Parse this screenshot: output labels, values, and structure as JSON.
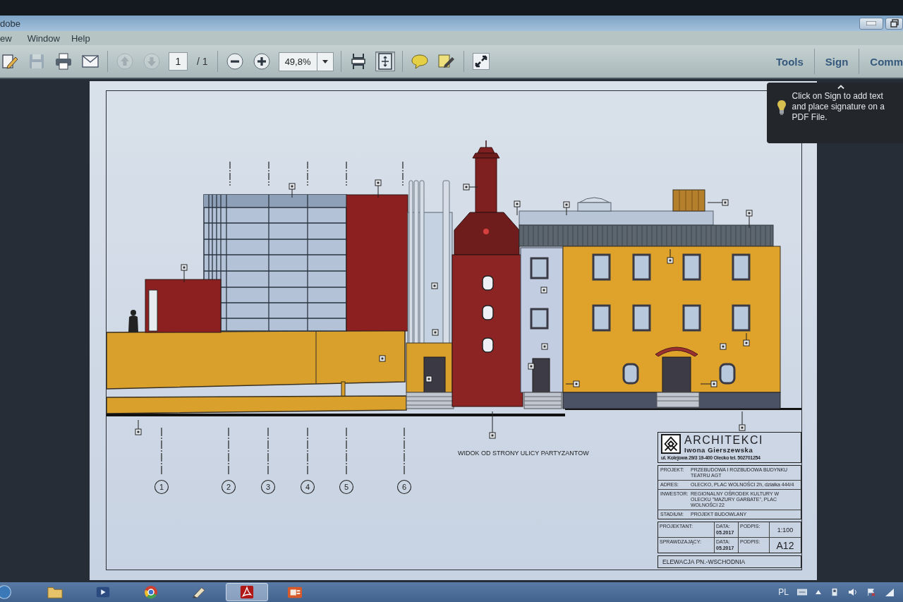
{
  "window": {
    "title": "dobe",
    "menu": [
      "ew",
      "Window",
      "Help"
    ]
  },
  "toolbar": {
    "groups": [
      [
        {
          "kind": "edit",
          "disabled": false
        },
        {
          "kind": "save",
          "disabled": true
        },
        {
          "kind": "print",
          "disabled": false
        },
        {
          "kind": "email",
          "disabled": false
        }
      ],
      [
        {
          "kind": "previous",
          "disabled": true
        },
        {
          "kind": "next",
          "disabled": true
        },
        {
          "kind": "page_field",
          "value": "1",
          "total": "/ 1"
        }
      ],
      [
        {
          "kind": "zoom_out",
          "disabled": false
        },
        {
          "kind": "zoom_in",
          "disabled": false
        },
        {
          "kind": "zoom_field",
          "value": "49,8%"
        }
      ],
      [
        {
          "kind": "scroll_mode",
          "selected": false
        },
        {
          "kind": "fit_page",
          "selected": true
        }
      ],
      [
        {
          "kind": "comment",
          "disabled": false
        },
        {
          "kind": "sign",
          "disabled": false
        }
      ],
      [
        {
          "kind": "full_screen",
          "disabled": false
        }
      ]
    ],
    "panes": [
      {
        "label": "Tools"
      },
      {
        "label": "Sign"
      },
      {
        "label": "Comm"
      }
    ]
  },
  "tooltip": {
    "text": "Click on Sign to add text and place signature on a PDF File."
  },
  "document": {
    "axes": [
      "1",
      "2",
      "3",
      "4",
      "5",
      "6"
    ],
    "caption": "WIDOK OD STRONY ULICY PARTYZANTOW",
    "title_block": {
      "firm": "ARCHITEKCI",
      "architect": "Iwona Gierszewska",
      "address": "ul. Kolejowa 29/3 19-400 Olecko tel. 502701254",
      "fields": [
        {
          "label": "PROJEKT:",
          "value": "PRZEBUDOWA I ROZBUDOWA BUDYNKU TEATRU AGT"
        },
        {
          "label": "ADRES:",
          "value": "OLECKO, PLAC WOLNOŚCI 2h, działka 444/4"
        },
        {
          "label": "INWESTOR:",
          "value": "REGIONALNY OŚRODEK KULTURY W OLECKU \"MAZURY GARBATE\", PLAC WOLNOŚCI 22"
        },
        {
          "label": "STADIUM:",
          "value": "PROJEKT BUDOWLANY"
        }
      ],
      "signoff": [
        {
          "role": "PROJEKTANT:",
          "date_label": "DATA:",
          "date": "05.2017",
          "sign_label": "PODPIS:",
          "code": "1:100"
        },
        {
          "role": "SPRAWDZAJĄCY:",
          "date_label": "DATA:",
          "date": "05.2017",
          "sign_label": "PODPIS:",
          "code": "A12"
        }
      ],
      "title": "ELEWACJA PN.-WSCHODNIA"
    }
  },
  "taskbar": {
    "apps": [
      {
        "kind": "explorer",
        "selected": false
      },
      {
        "kind": "media",
        "selected": false
      },
      {
        "kind": "browser",
        "selected": false
      },
      {
        "kind": "tool",
        "selected": false
      },
      {
        "kind": "pdf",
        "selected": true
      },
      {
        "kind": "presentation",
        "selected": false
      }
    ],
    "language": "PL"
  }
}
